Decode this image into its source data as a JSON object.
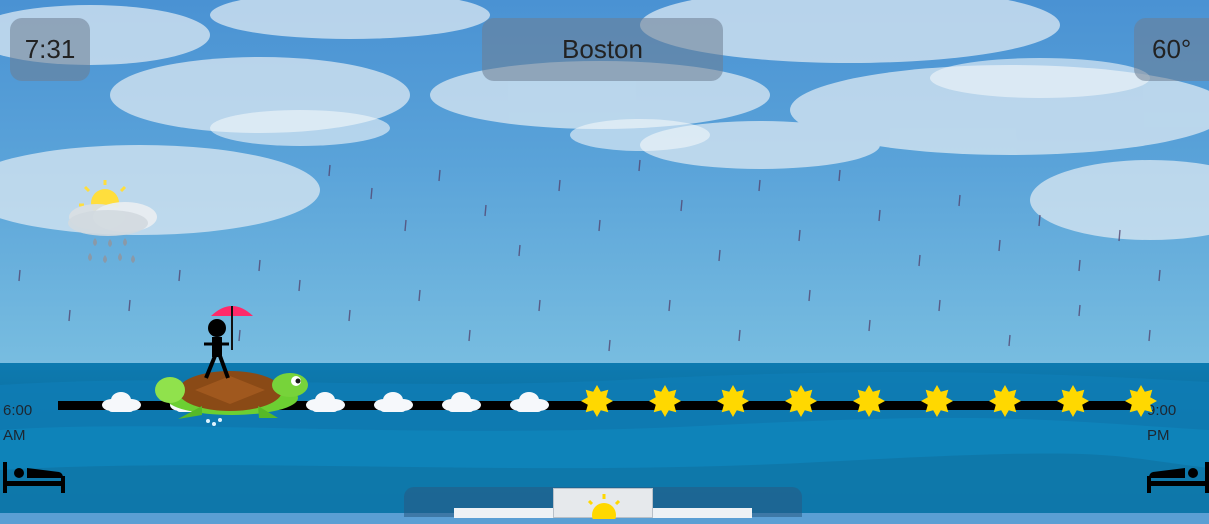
{
  "header": {
    "time": "7:31",
    "city": "Boston",
    "temperature": "60°"
  },
  "timeline": {
    "start_time": "6:00",
    "start_period": "AM",
    "end_time": "9:00",
    "end_period": "PM",
    "hours": [
      {
        "icon": "cloud-icon"
      },
      {
        "icon": "cloud-icon"
      },
      {
        "icon": "cloud-icon"
      },
      {
        "icon": "cloud-icon"
      },
      {
        "icon": "cloud-icon"
      },
      {
        "icon": "cloud-icon"
      },
      {
        "icon": "cloud-icon"
      },
      {
        "icon": "sun-icon"
      },
      {
        "icon": "sun-icon"
      },
      {
        "icon": "sun-icon"
      },
      {
        "icon": "sun-icon"
      },
      {
        "icon": "sun-icon"
      },
      {
        "icon": "sun-icon"
      },
      {
        "icon": "sun-icon"
      },
      {
        "icon": "sun-icon"
      },
      {
        "icon": "sun-icon"
      }
    ]
  },
  "current_weather_icon": "sun-cloud-rain-icon",
  "bottom_tabs": [
    "",
    "sun-icon",
    ""
  ],
  "colors": {
    "sea": "#0f6f99",
    "sun": "#ffd800",
    "umbrella": "#ff2a6a",
    "turtle_shell": "#8a4a16",
    "turtle_skin": "#6ccf32"
  }
}
